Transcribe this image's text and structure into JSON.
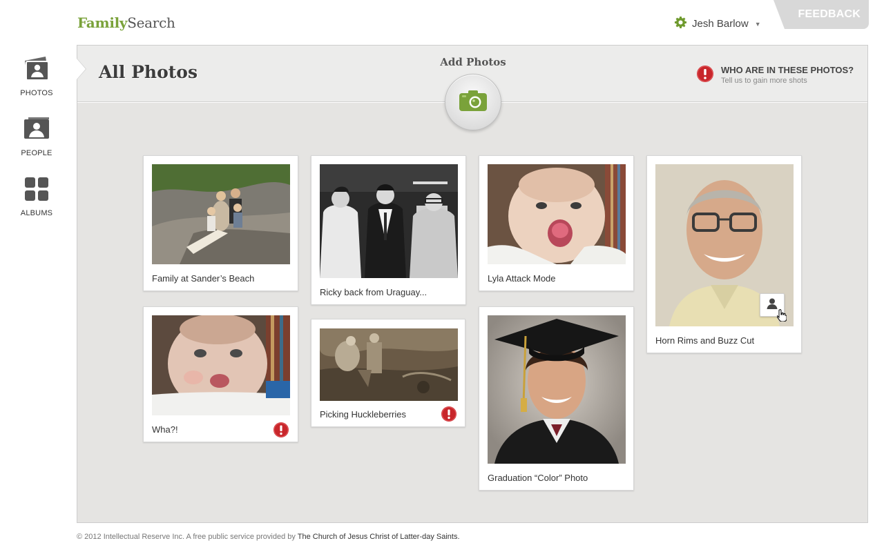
{
  "brand": {
    "part1": "Family",
    "part2": "Search",
    "accent": "#7aa23a"
  },
  "header": {
    "user_name": "Jesh Barlow",
    "user_icon": "gear-icon",
    "feedback_label": "FEEDBACK"
  },
  "sidebar": {
    "items": [
      {
        "label": "PHOTOS",
        "icon": "photos-icon"
      },
      {
        "label": "PEOPLE",
        "icon": "people-icon"
      },
      {
        "label": "ALBUMS",
        "icon": "albums-icon"
      }
    ]
  },
  "main": {
    "title": "All Photos",
    "add_photos_label": "Add Photos",
    "who_title": "WHO ARE IN THESE PHOTOS?",
    "who_subtitle": "Tell us to gain more shots"
  },
  "photos": [
    {
      "caption": "Family at Sander’s Beach"
    },
    {
      "caption": "Ricky back from Uraguay..."
    },
    {
      "caption": "Lyla Attack Mode"
    },
    {
      "caption": "Horn Rims and Buzz Cut"
    },
    {
      "caption": "Wha?!"
    },
    {
      "caption": "Picking Huckleberries"
    },
    {
      "caption": "Graduation “Color” Photo"
    }
  ],
  "footer": {
    "text": "© 2012 Intellectual Reserve Inc. A free public service provided by ",
    "link": "The Church of Jesus Christ of Latter-day Saints."
  }
}
